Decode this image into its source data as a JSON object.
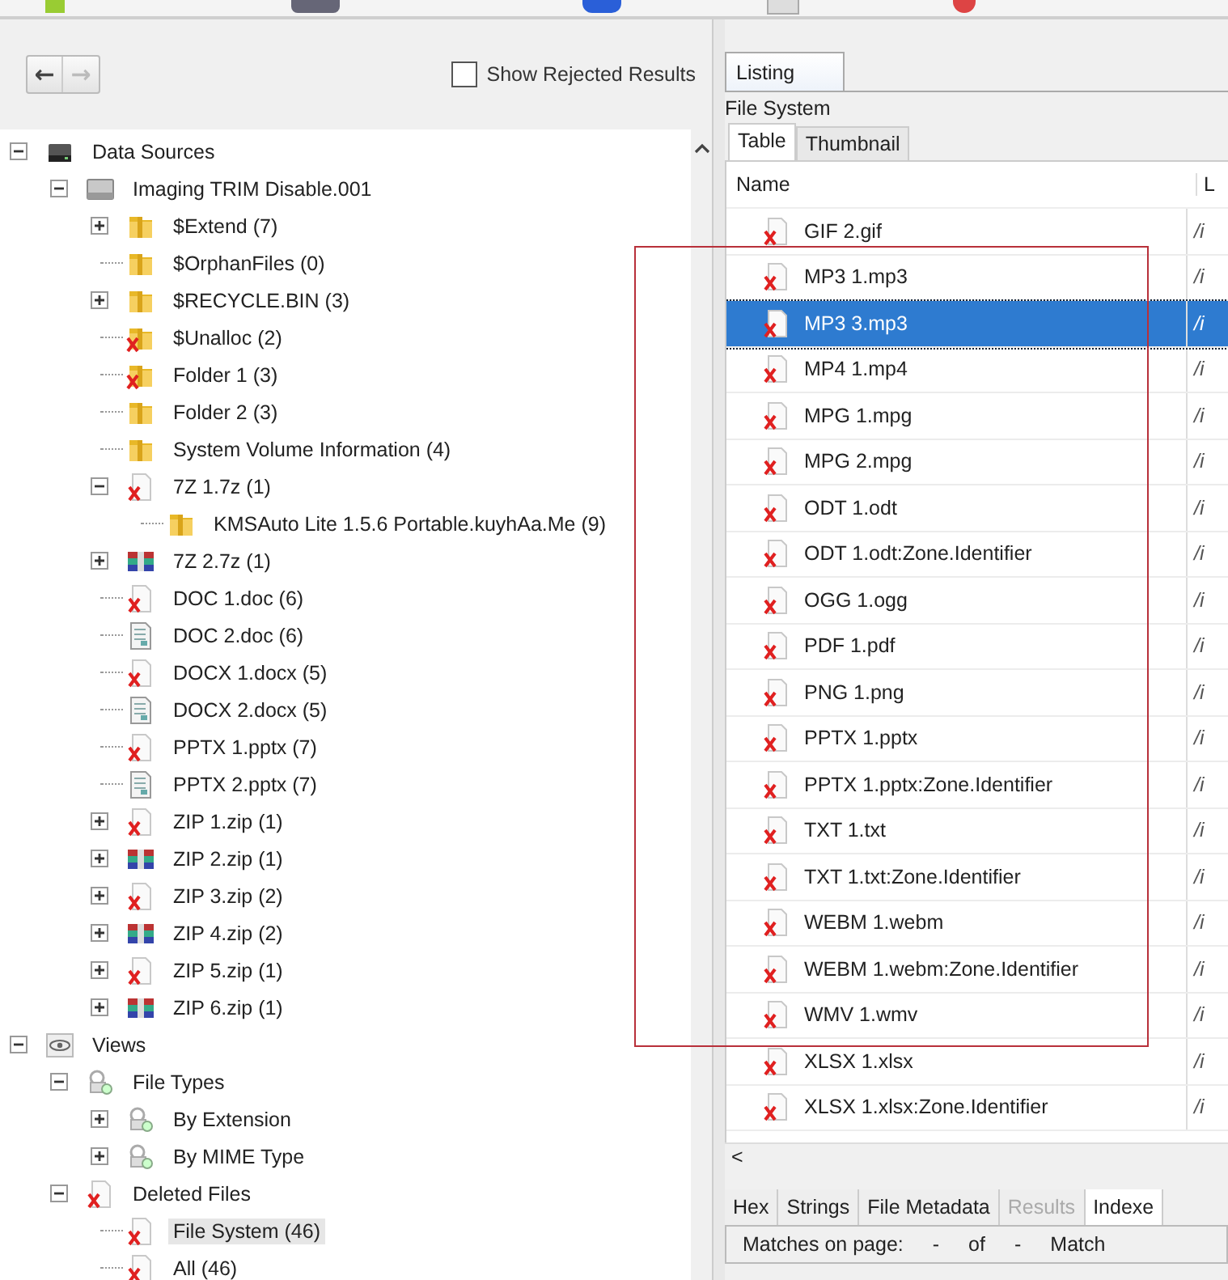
{
  "navigation": {
    "back": "←",
    "forward": "→"
  },
  "show_rejected": {
    "label": "Show Rejected Results",
    "checked": false
  },
  "tree": [
    {
      "label": "Data Sources",
      "kind": "drive",
      "expanded": true,
      "selected": false,
      "children": [
        {
          "label": "Imaging TRIM Disable.001",
          "kind": "disk",
          "expanded": true,
          "selected": false,
          "children": [
            {
              "label": "$Extend (7)",
              "kind": "folder",
              "expanded": false,
              "selected": false
            },
            {
              "label": "$OrphanFiles (0)",
              "kind": "folder",
              "selected": false
            },
            {
              "label": "$RECYCLE.BIN (3)",
              "kind": "folder",
              "expanded": false,
              "selected": false
            },
            {
              "label": "$Unalloc (2)",
              "kind": "deleted-folder",
              "selected": false
            },
            {
              "label": "Folder 1 (3)",
              "kind": "deleted-folder",
              "selected": false
            },
            {
              "label": "Folder 2 (3)",
              "kind": "folder",
              "selected": false
            },
            {
              "label": "System Volume Information (4)",
              "kind": "folder",
              "selected": false
            },
            {
              "label": "7Z 1.7z (1)",
              "kind": "deleted-file",
              "expanded": true,
              "selected": false,
              "children": [
                {
                  "label": "KMSAuto Lite 1.5.6 Portable.kuyhAa.Me (9)",
                  "kind": "folder",
                  "selected": false
                }
              ]
            },
            {
              "label": "7Z 2.7z (1)",
              "kind": "archive",
              "expanded": false,
              "selected": false
            },
            {
              "label": "DOC 1.doc (6)",
              "kind": "deleted-file",
              "selected": false
            },
            {
              "label": "DOC 2.doc (6)",
              "kind": "document",
              "selected": false
            },
            {
              "label": "DOCX 1.docx (5)",
              "kind": "deleted-file",
              "selected": false
            },
            {
              "label": "DOCX 2.docx (5)",
              "kind": "document",
              "selected": false
            },
            {
              "label": "PPTX 1.pptx (7)",
              "kind": "deleted-file",
              "selected": false
            },
            {
              "label": "PPTX 2.pptx (7)",
              "kind": "document",
              "selected": false
            },
            {
              "label": "ZIP 1.zip (1)",
              "kind": "deleted-file",
              "expanded": false,
              "selected": false
            },
            {
              "label": "ZIP 2.zip (1)",
              "kind": "archive",
              "expanded": false,
              "selected": false
            },
            {
              "label": "ZIP 3.zip (2)",
              "kind": "deleted-file",
              "expanded": false,
              "selected": false
            },
            {
              "label": "ZIP 4.zip (2)",
              "kind": "archive",
              "expanded": false,
              "selected": false
            },
            {
              "label": "ZIP 5.zip (1)",
              "kind": "deleted-file",
              "expanded": false,
              "selected": false
            },
            {
              "label": "ZIP 6.zip (1)",
              "kind": "archive",
              "expanded": false,
              "selected": false
            }
          ]
        }
      ]
    },
    {
      "label": "Views",
      "kind": "eye",
      "expanded": true,
      "selected": false,
      "children": [
        {
          "label": "File Types",
          "kind": "types",
          "expanded": true,
          "selected": false,
          "children": [
            {
              "label": "By Extension",
              "kind": "types",
              "expanded": false,
              "selected": false
            },
            {
              "label": "By MIME Type",
              "kind": "types",
              "expanded": false,
              "selected": false
            }
          ]
        },
        {
          "label": "Deleted Files",
          "kind": "deleted-file",
          "expanded": true,
          "selected": false,
          "children": [
            {
              "label": "File System (46)",
              "kind": "deleted-file",
              "selected": true
            },
            {
              "label": "All (46)",
              "kind": "deleted-file",
              "selected": false
            }
          ]
        }
      ]
    }
  ],
  "listing_tab": {
    "label": "Listing",
    "selected": true
  },
  "listing_title": "File System",
  "view_tabs": [
    {
      "label": "Table",
      "selected": true
    },
    {
      "label": "Thumbnail",
      "selected": false
    }
  ],
  "table": {
    "columns": [
      "Name",
      "L"
    ],
    "rows": [
      {
        "name": "GIF 2.gif",
        "column_2": "/i",
        "selected": false
      },
      {
        "name": "MP3 1.mp3",
        "column_2": "/i",
        "selected": false
      },
      {
        "name": "MP3 3.mp3",
        "column_2": "/i",
        "selected": true
      },
      {
        "name": "MP4 1.mp4",
        "column_2": "/i",
        "selected": false
      },
      {
        "name": "MPG 1.mpg",
        "column_2": "/i",
        "selected": false
      },
      {
        "name": "MPG 2.mpg",
        "column_2": "/i",
        "selected": false
      },
      {
        "name": "ODT 1.odt",
        "column_2": "/i",
        "selected": false
      },
      {
        "name": "ODT 1.odt:Zone.Identifier",
        "column_2": "/i",
        "selected": false
      },
      {
        "name": "OGG 1.ogg",
        "column_2": "/i",
        "selected": false
      },
      {
        "name": "PDF 1.pdf",
        "column_2": "/i",
        "selected": false
      },
      {
        "name": "PNG 1.png",
        "column_2": "/i",
        "selected": false
      },
      {
        "name": "PPTX 1.pptx",
        "column_2": "/i",
        "selected": false
      },
      {
        "name": "PPTX 1.pptx:Zone.Identifier",
        "column_2": "/i",
        "selected": false
      },
      {
        "name": "TXT 1.txt",
        "column_2": "/i",
        "selected": false
      },
      {
        "name": "TXT 1.txt:Zone.Identifier",
        "column_2": "/i",
        "selected": false
      },
      {
        "name": "WEBM 1.webm",
        "column_2": "/i",
        "selected": false
      },
      {
        "name": "WEBM 1.webm:Zone.Identifier",
        "column_2": "/i",
        "selected": false
      },
      {
        "name": "WMV 1.wmv",
        "column_2": "/i",
        "selected": false
      },
      {
        "name": "XLSX 1.xlsx",
        "column_2": "/i",
        "selected": false
      },
      {
        "name": "XLSX 1.xlsx:Zone.Identifier",
        "column_2": "/i",
        "selected": false
      }
    ]
  },
  "scroll_left": "<",
  "content_tabs": [
    {
      "label": "Hex",
      "selected": false,
      "disabled": false
    },
    {
      "label": "Strings",
      "selected": false,
      "disabled": false
    },
    {
      "label": "File Metadata",
      "selected": false,
      "disabled": false
    },
    {
      "label": "Results",
      "selected": false,
      "disabled": true
    },
    {
      "label": "Indexe",
      "selected": true,
      "disabled": false
    }
  ],
  "matches_bar": [
    "Matches on page:",
    "-",
    "of",
    "-",
    "Match"
  ]
}
